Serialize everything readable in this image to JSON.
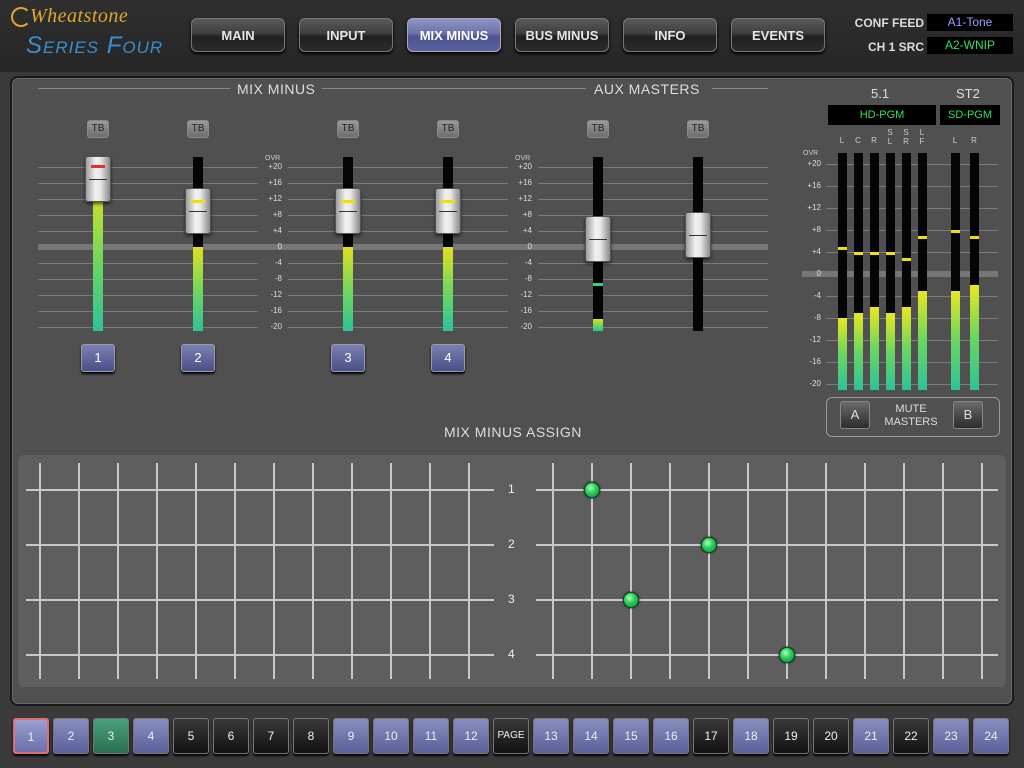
{
  "brand": {
    "name": "Wheatstone",
    "product": "Series Four"
  },
  "nav": [
    {
      "label": "MAIN",
      "active": false
    },
    {
      "label": "INPUT",
      "active": false
    },
    {
      "label": "MIX MINUS",
      "active": true
    },
    {
      "label": "BUS MINUS",
      "active": false
    },
    {
      "label": "INFO",
      "active": false
    },
    {
      "label": "EVENTS",
      "active": false
    }
  ],
  "header_fields": [
    {
      "label": "CONF FEED",
      "value": "A1-Tone",
      "color": "#9aa0ff"
    },
    {
      "label": "CH 1 SRC",
      "value": "A2-WNIP",
      "color": "#30e060"
    }
  ],
  "sections": {
    "mix_minus": "MIX MINUS",
    "aux_masters": "AUX MASTERS",
    "assign": "MIX MINUS ASSIGN"
  },
  "tb_label": "TB",
  "scale": {
    "ovr": "OVR",
    "marks": [
      "+20",
      "+16",
      "+12",
      "+8",
      "+4",
      "0",
      "-4",
      "-8",
      "-12",
      "-16",
      "-20"
    ]
  },
  "mix_minus_faders": [
    {
      "label": "1",
      "meter_db": 16,
      "fader_db": 17,
      "peak_color": "red"
    },
    {
      "label": "2",
      "meter_db": 0,
      "fader_db": 9,
      "peak_color": "yellow"
    },
    {
      "label": "3",
      "meter_db": 0,
      "fader_db": 9,
      "peak_color": "yellow"
    },
    {
      "label": "4",
      "meter_db": 0,
      "fader_db": 9,
      "peak_color": "yellow"
    }
  ],
  "aux_masters": [
    {
      "meter_db": -18,
      "peak_db": -9,
      "fader_db": 2
    },
    {
      "meter_db": null,
      "peak_db": null,
      "fader_db": 3
    }
  ],
  "meters": {
    "title_51": "5.1",
    "title_st2": "ST2",
    "src_51": "HD-PGM",
    "src_st2": "SD-PGM",
    "scale": [
      "OVR",
      "+20",
      "+16",
      "+12",
      "+8",
      "+4",
      "0",
      "-4",
      "-8",
      "-12",
      "-16",
      "-20"
    ],
    "channels_51": [
      {
        "label": "L",
        "level_db": -8,
        "peak_db": 5
      },
      {
        "label": "C",
        "level_db": -7,
        "peak_db": 4
      },
      {
        "label": "R",
        "level_db": -6,
        "peak_db": 4
      },
      {
        "label": "S L",
        "level_db": -7,
        "peak_db": 4
      },
      {
        "label": "S R",
        "level_db": -6,
        "peak_db": 3
      },
      {
        "label": "L F",
        "level_db": -3,
        "peak_db": 7
      }
    ],
    "channels_st2": [
      {
        "label": "L",
        "level_db": -3,
        "peak_db": 8
      },
      {
        "label": "R",
        "level_db": -2,
        "peak_db": 7
      }
    ]
  },
  "mute_masters": {
    "label_line1": "MUTE",
    "label_line2": "MASTERS",
    "a": "A",
    "b": "B"
  },
  "assign": {
    "rows": [
      "1",
      "2",
      "3",
      "4"
    ],
    "assigned": [
      {
        "row": 1,
        "column": 14
      },
      {
        "row": 2,
        "column": 17
      },
      {
        "row": 3,
        "column": 15
      },
      {
        "row": 4,
        "column": 19
      }
    ]
  },
  "pages": [
    {
      "label": "1",
      "style": "selected"
    },
    {
      "label": "2",
      "style": "blue"
    },
    {
      "label": "3",
      "style": "green"
    },
    {
      "label": "4",
      "style": "blue"
    },
    {
      "label": "5",
      "style": "dark"
    },
    {
      "label": "6",
      "style": "dark"
    },
    {
      "label": "7",
      "style": "dark"
    },
    {
      "label": "8",
      "style": "dark"
    },
    {
      "label": "9",
      "style": "blue"
    },
    {
      "label": "10",
      "style": "blue"
    },
    {
      "label": "11",
      "style": "blue"
    },
    {
      "label": "12",
      "style": "blue"
    },
    {
      "label": "PAGE",
      "style": "dark"
    },
    {
      "label": "13",
      "style": "blue"
    },
    {
      "label": "14",
      "style": "blue"
    },
    {
      "label": "15",
      "style": "blue"
    },
    {
      "label": "16",
      "style": "blue"
    },
    {
      "label": "17",
      "style": "dark"
    },
    {
      "label": "18",
      "style": "blue"
    },
    {
      "label": "19",
      "style": "dark"
    },
    {
      "label": "20",
      "style": "dark"
    },
    {
      "label": "21",
      "style": "blue"
    },
    {
      "label": "22",
      "style": "dark"
    },
    {
      "label": "23",
      "style": "blue"
    },
    {
      "label": "24",
      "style": "blue"
    }
  ]
}
